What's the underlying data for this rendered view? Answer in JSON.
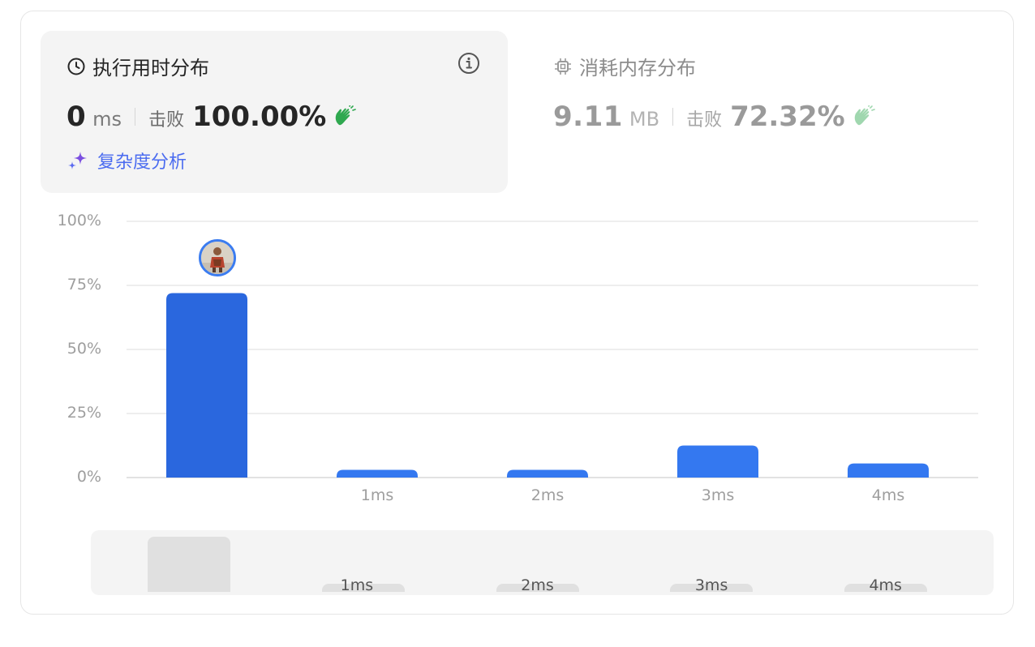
{
  "runtime": {
    "title": "执行用时分布",
    "value": "0",
    "unit": "ms",
    "beats_label": "击败",
    "beats_pct": "100.00%"
  },
  "memory": {
    "title": "消耗内存分布",
    "value": "9.11",
    "unit": "MB",
    "beats_label": "击败",
    "beats_pct": "72.32%"
  },
  "complexity_link": "复杂度分析",
  "icons": {
    "runtime": "clock-icon",
    "memory": "chip-icon",
    "info": "info-icon",
    "complexity": "sparkle-icon",
    "clap": "clapping-hands-icon"
  },
  "colors": {
    "bar": "#3478f0",
    "bar_active": "#2a67de",
    "success": "#2fa84f",
    "link": "#4b6cf0",
    "sparkle": "#7b4fe0"
  },
  "chart_data": {
    "type": "bar",
    "categories": [
      "",
      "1ms",
      "2ms",
      "3ms",
      "4ms"
    ],
    "values": [
      72,
      3,
      3,
      12.5,
      5.5
    ],
    "highlighted_index": 0,
    "yticks": [
      "100%",
      "75%",
      "50%",
      "25%",
      "0%"
    ],
    "ylim": [
      0,
      100
    ],
    "grid": true,
    "xlabel": "",
    "ylabel": ""
  },
  "overview": {
    "labels": [
      "1ms",
      "2ms",
      "3ms",
      "4ms"
    ]
  }
}
